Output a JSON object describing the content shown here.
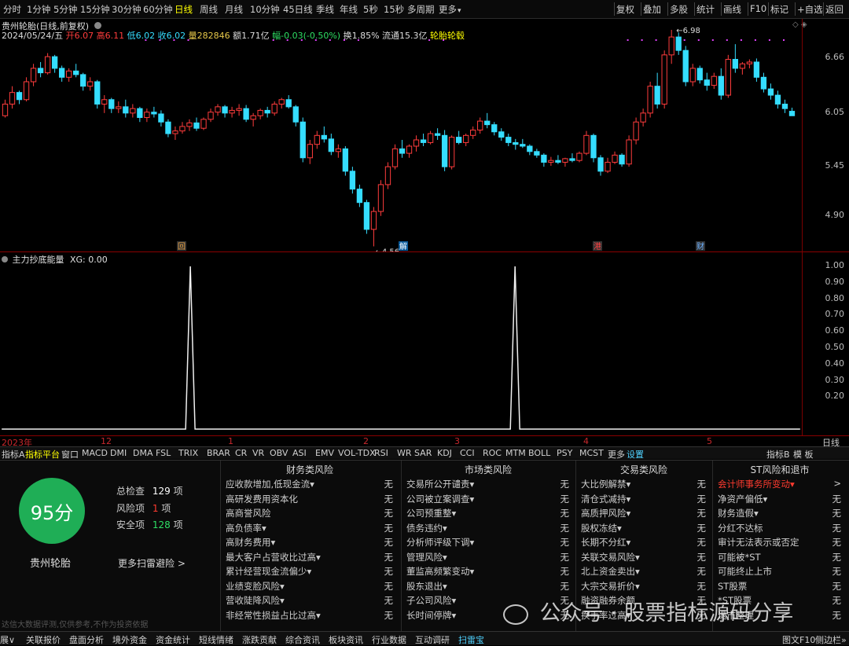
{
  "toolbar": {
    "periods": [
      "分时",
      "1分钟",
      "5分钟",
      "15分钟",
      "30分钟",
      "60分钟",
      "日线",
      "周线",
      "月线",
      "10分钟",
      "45日线",
      "季线",
      "年线",
      "5秒",
      "15秒",
      "多周期",
      "更多"
    ],
    "active_period": "日线",
    "right_buttons": [
      "复权",
      "叠加",
      "多股",
      "统计",
      "画线",
      "F10",
      "标记",
      "+自选",
      "返回"
    ]
  },
  "chart_header": {
    "title": "贵州轮胎(日线,前复权)",
    "date": "2024/05/24/五",
    "open": "开6.07",
    "high": "高6.11",
    "low": "低6.02",
    "close": "收6.02",
    "volume": "量282846",
    "amount": "额1.71亿",
    "change": "幅-0.03(-0.50%)",
    "turnover": "换1.85%",
    "float_cap": "流通15.3亿",
    "sector": "轮胎轮毂"
  },
  "price_scale": [
    "6.66",
    "6.05",
    "5.45",
    "4.90"
  ],
  "price_annotations": {
    "high": "6.98",
    "low": "4.56"
  },
  "event_markers": [
    "回",
    "解",
    "港",
    "财"
  ],
  "colors": {
    "up": "#ff3c3c",
    "down": "#35ddff",
    "accent_yellow": "#ffff00",
    "marker_magenta": "#e040fb",
    "score_green": "#1fae56",
    "grid_red": "#8a0000"
  },
  "indicator": {
    "title": "主力抄底能量",
    "value_label": "XG: 0.00",
    "scale": [
      "1.00",
      "0.90",
      "0.80",
      "0.70",
      "0.60",
      "0.50",
      "0.40",
      "0.30",
      "0.20"
    ]
  },
  "date_axis": {
    "labels": [
      "2023年",
      "12",
      "1",
      "2",
      "3",
      "4",
      "5"
    ],
    "right_label": "日线"
  },
  "indicator_tabs": [
    "指标A",
    "指标平台",
    "窗口",
    "MACD",
    "DMI",
    "DMA",
    "FSL",
    "TRIX",
    "BRAR",
    "CR",
    "VR",
    "OBV",
    "ASI",
    "EMV",
    "VOL-TDX",
    "RSI",
    "WR",
    "SAR",
    "KDJ",
    "CCI",
    "ROC",
    "MTM",
    "BOLL",
    "PSY",
    "MCST",
    "更多",
    "设置"
  ],
  "indicator_tabs_right": [
    "指标B",
    "模 板"
  ],
  "scan": {
    "score": "95分",
    "stock_name": "贵州轮胎",
    "total_label": "总检查",
    "total_value": "129",
    "risk_label": "风险项",
    "risk_value": "1",
    "safe_label": "安全项",
    "safe_value": "128",
    "unit": "项",
    "more_link": "更多扫雷避险 >",
    "disclaimer": "达信大数据评测,仅供参考,不作为投资依据",
    "columns": [
      {
        "title": "财务类风险",
        "items": [
          "应收款增加,低现金流▾",
          "高研发费用资本化",
          "高商誉风险",
          "高负债率▾",
          "高财务费用▾",
          "最大客户占营收比过高▾",
          "累计经营现金流偏少▾",
          "业绩变脸风险▾",
          "营收陡降风险▾",
          "非经常性损益占比过高▾"
        ],
        "values": [
          "无",
          "无",
          "无",
          "无",
          "无",
          "无",
          "无",
          "无",
          "无",
          "无"
        ]
      },
      {
        "title": "市场类风险",
        "items": [
          "交易所公开谴责▾",
          "公司被立案调查▾",
          "公司预重整▾",
          "债务违约▾",
          "分析师评级下调▾",
          "管理风险▾",
          "董监高频繁变动▾",
          "股东退出▾",
          "子公司风险▾",
          "长时间停牌▾"
        ],
        "values": [
          "无",
          "无",
          "无",
          "无",
          "无",
          "无",
          "无",
          "无",
          "无",
          "无"
        ]
      },
      {
        "title": "交易类风险",
        "items": [
          "大比例解禁▾",
          "清仓式减持▾",
          "高质押风险▾",
          "股权冻结▾",
          "长期不分红▾",
          "关联交易风险▾",
          "北上资金卖出▾",
          "大宗交易折价▾",
          "融资融券余额",
          "换手率过高▾"
        ],
        "values": [
          "无",
          "无",
          "无",
          "无",
          "无",
          "无",
          "无",
          "无",
          "无",
          "无"
        ]
      },
      {
        "title": "ST风险和退市",
        "items": [
          "会计师事务所变动▾",
          "净资产偏低▾",
          "财务造假▾",
          "分红不达标",
          "审计无法表示或否定",
          "可能被*ST",
          "可能终止上市",
          "ST股票",
          "*ST股票",
          "退市整理"
        ],
        "values": [
          ">",
          "无",
          "无",
          "无",
          "无",
          "无",
          "无",
          "无",
          "无",
          "无"
        ]
      }
    ]
  },
  "watermark": "公众号 · 股票指标源码分享",
  "bottom_tabs": [
    "展∨",
    "关联报价",
    "盘面分析",
    "境外资金",
    "资金统计",
    "短线情绪",
    "涨跌贡献",
    "综合资讯",
    "板块资讯",
    "行业数据",
    "互动调研",
    "扫雷宝"
  ],
  "bottom_right": [
    "图文F10",
    "侧边栏»"
  ],
  "chart_data": {
    "type": "candlestick",
    "title": "贵州轮胎(日线,前复权)",
    "x_labels": [
      "2023年",
      "12",
      "1",
      "2",
      "3",
      "4",
      "5"
    ],
    "ylim": [
      4.45,
      7.05
    ],
    "candles": [
      [
        6.02,
        6.2,
        6.0,
        6.15
      ],
      [
        6.15,
        6.35,
        6.1,
        6.28
      ],
      [
        6.28,
        6.3,
        6.15,
        6.2
      ],
      [
        6.2,
        6.45,
        6.18,
        6.4
      ],
      [
        6.4,
        6.6,
        6.35,
        6.55
      ],
      [
        6.55,
        6.62,
        6.45,
        6.5
      ],
      [
        6.5,
        6.72,
        6.48,
        6.68
      ],
      [
        6.68,
        6.7,
        6.5,
        6.55
      ],
      [
        6.55,
        6.58,
        6.4,
        6.45
      ],
      [
        6.45,
        6.55,
        6.4,
        6.52
      ],
      [
        6.52,
        6.6,
        6.45,
        6.48
      ],
      [
        6.48,
        6.5,
        6.3,
        6.35
      ],
      [
        6.35,
        6.45,
        6.3,
        6.4
      ],
      [
        6.4,
        6.42,
        6.1,
        6.15
      ],
      [
        6.15,
        6.25,
        6.05,
        6.2
      ],
      [
        6.2,
        6.22,
        6.05,
        6.1
      ],
      [
        6.1,
        6.18,
        6.05,
        6.12
      ],
      [
        6.12,
        6.2,
        6.0,
        6.05
      ],
      [
        6.05,
        6.15,
        6.0,
        6.1
      ],
      [
        6.1,
        6.12,
        5.95,
        6.0
      ],
      [
        6.0,
        6.1,
        5.95,
        6.06
      ],
      [
        6.06,
        6.12,
        6.0,
        6.04
      ],
      [
        6.04,
        6.08,
        5.9,
        5.95
      ],
      [
        5.95,
        5.98,
        5.78,
        5.82
      ],
      [
        5.82,
        5.9,
        5.75,
        5.85
      ],
      [
        5.85,
        5.95,
        5.82,
        5.9
      ],
      [
        5.9,
        5.98,
        5.85,
        5.94
      ],
      [
        5.94,
        6.0,
        5.85,
        5.88
      ],
      [
        5.88,
        6.0,
        5.86,
        5.98
      ],
      [
        5.98,
        6.1,
        5.95,
        6.06
      ],
      [
        6.06,
        6.15,
        6.02,
        6.12
      ],
      [
        6.12,
        6.14,
        6.0,
        6.05
      ],
      [
        6.05,
        6.12,
        6.0,
        6.08
      ],
      [
        6.08,
        6.15,
        6.02,
        6.1
      ],
      [
        6.1,
        6.14,
        5.95,
        5.98
      ],
      [
        5.98,
        6.05,
        5.9,
        6.02
      ],
      [
        6.02,
        6.1,
        5.98,
        6.08
      ],
      [
        6.08,
        6.12,
        6.0,
        6.05
      ],
      [
        6.05,
        6.18,
        6.02,
        6.15
      ],
      [
        6.15,
        6.22,
        6.1,
        6.2
      ],
      [
        6.2,
        6.25,
        6.1,
        6.12
      ],
      [
        6.12,
        6.14,
        5.9,
        5.95
      ],
      [
        5.95,
        6.0,
        5.5,
        5.55
      ],
      [
        5.55,
        5.75,
        5.48,
        5.7
      ],
      [
        5.7,
        5.85,
        5.65,
        5.8
      ],
      [
        5.8,
        5.9,
        5.72,
        5.76
      ],
      [
        5.76,
        5.82,
        5.58,
        5.62
      ],
      [
        5.62,
        5.7,
        5.55,
        5.65
      ],
      [
        5.65,
        5.68,
        5.35,
        5.4
      ],
      [
        5.4,
        5.45,
        5.15,
        5.2
      ],
      [
        5.2,
        5.25,
        5.0,
        5.05
      ],
      [
        5.05,
        5.08,
        4.7,
        4.75
      ],
      [
        4.75,
        5.0,
        4.56,
        4.95
      ],
      [
        4.95,
        5.3,
        4.9,
        5.25
      ],
      [
        5.25,
        5.5,
        5.2,
        5.45
      ],
      [
        5.45,
        5.7,
        5.42,
        5.65
      ],
      [
        5.65,
        5.75,
        5.55,
        5.6
      ],
      [
        5.6,
        5.7,
        5.55,
        5.68
      ],
      [
        5.68,
        5.8,
        5.62,
        5.75
      ],
      [
        5.75,
        5.82,
        5.68,
        5.72
      ],
      [
        5.72,
        5.85,
        5.7,
        5.82
      ],
      [
        5.82,
        5.88,
        5.75,
        5.8
      ],
      [
        5.8,
        5.86,
        5.4,
        5.45
      ],
      [
        5.45,
        5.8,
        5.42,
        5.78
      ],
      [
        5.78,
        5.85,
        5.7,
        5.72
      ],
      [
        5.72,
        5.82,
        5.68,
        5.8
      ],
      [
        5.8,
        5.9,
        5.76,
        5.86
      ],
      [
        5.86,
        6.0,
        5.82,
        5.96
      ],
      [
        5.96,
        6.05,
        5.88,
        5.92
      ],
      [
        5.92,
        5.95,
        5.8,
        5.84
      ],
      [
        5.84,
        5.88,
        5.74,
        5.78
      ],
      [
        5.78,
        5.82,
        5.68,
        5.72
      ],
      [
        5.72,
        5.76,
        5.64,
        5.7
      ],
      [
        5.7,
        5.76,
        5.66,
        5.68
      ],
      [
        5.68,
        5.7,
        5.58,
        5.62
      ],
      [
        5.62,
        5.65,
        5.55,
        5.58
      ],
      [
        5.58,
        5.6,
        5.45,
        5.5
      ],
      [
        5.5,
        5.56,
        5.46,
        5.52
      ],
      [
        5.52,
        5.58,
        5.48,
        5.5
      ],
      [
        5.5,
        5.55,
        5.45,
        5.54
      ],
      [
        5.54,
        5.6,
        5.5,
        5.52
      ],
      [
        5.52,
        5.62,
        5.5,
        5.6
      ],
      [
        5.6,
        5.85,
        5.58,
        5.8
      ],
      [
        5.8,
        5.82,
        5.5,
        5.55
      ],
      [
        5.55,
        5.58,
        5.35,
        5.4
      ],
      [
        5.4,
        5.55,
        5.38,
        5.5
      ],
      [
        5.5,
        5.62,
        5.48,
        5.58
      ],
      [
        5.58,
        5.6,
        5.45,
        5.48
      ],
      [
        5.48,
        5.8,
        5.45,
        5.75
      ],
      [
        5.75,
        6.0,
        5.7,
        5.95
      ],
      [
        5.95,
        6.1,
        5.9,
        6.05
      ],
      [
        6.05,
        6.4,
        6.0,
        6.35
      ],
      [
        6.35,
        6.5,
        6.1,
        6.15
      ],
      [
        6.15,
        6.75,
        6.1,
        6.7
      ],
      [
        6.7,
        6.98,
        6.6,
        6.9
      ],
      [
        6.9,
        6.95,
        6.7,
        6.75
      ],
      [
        6.75,
        6.8,
        6.35,
        6.4
      ],
      [
        6.4,
        6.6,
        6.35,
        6.55
      ],
      [
        6.55,
        6.58,
        6.38,
        6.42
      ],
      [
        6.42,
        6.5,
        6.3,
        6.36
      ],
      [
        6.36,
        6.5,
        6.32,
        6.46
      ],
      [
        6.46,
        6.55,
        6.2,
        6.25
      ],
      [
        6.25,
        6.7,
        6.22,
        6.65
      ],
      [
        6.65,
        6.82,
        6.5,
        6.55
      ],
      [
        6.55,
        6.62,
        6.48,
        6.6
      ],
      [
        6.6,
        6.65,
        6.55,
        6.62
      ],
      [
        6.62,
        6.66,
        6.4,
        6.45
      ],
      [
        6.45,
        6.5,
        6.28,
        6.32
      ],
      [
        6.32,
        6.38,
        6.2,
        6.25
      ],
      [
        6.25,
        6.3,
        6.1,
        6.15
      ],
      [
        6.15,
        6.2,
        6.05,
        6.1
      ],
      [
        6.07,
        6.11,
        6.02,
        6.02
      ]
    ],
    "indicator_series": {
      "name": "XG",
      "values_nonzero": [
        [
          26,
          1.0
        ],
        [
          72,
          1.0
        ]
      ],
      "length": 112
    }
  }
}
